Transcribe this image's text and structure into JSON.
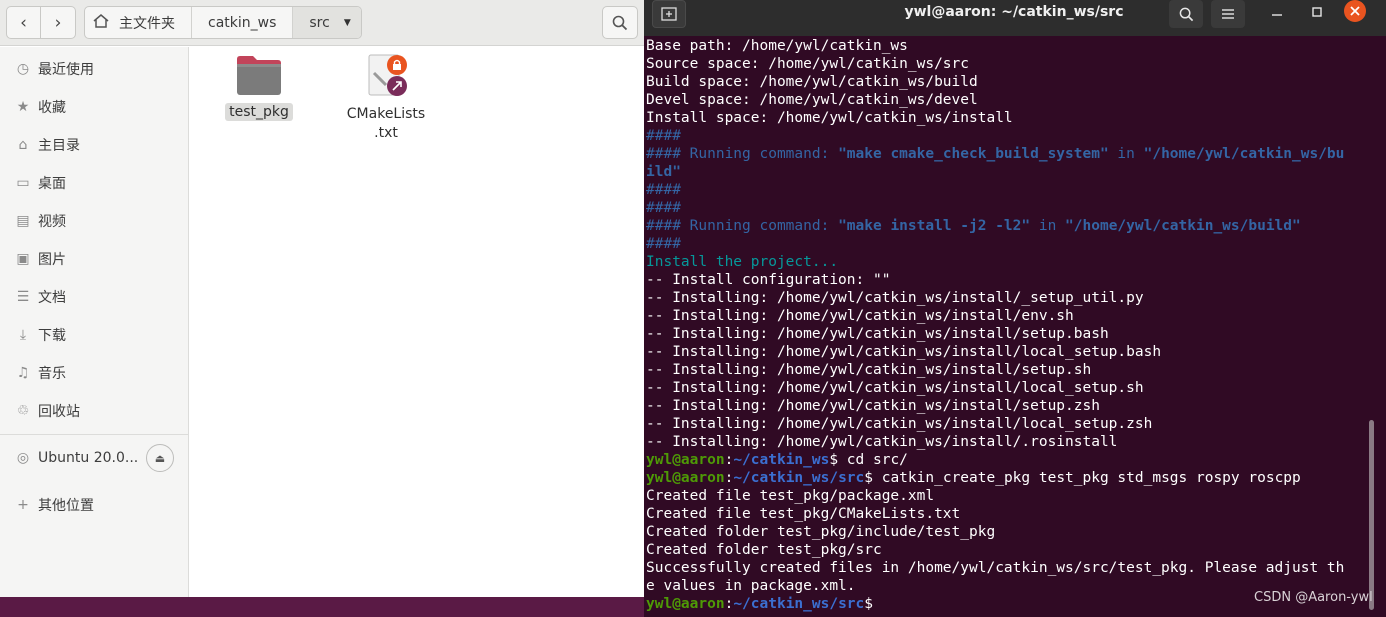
{
  "file_manager": {
    "breadcrumbs": [
      "主文件夹",
      "catkin_ws",
      "src"
    ],
    "sidebar": [
      {
        "label": "最近使用",
        "icon": "clock-icon"
      },
      {
        "label": "收藏",
        "icon": "star-icon"
      },
      {
        "label": "主目录",
        "icon": "home-icon"
      },
      {
        "label": "桌面",
        "icon": "desktop-icon"
      },
      {
        "label": "视频",
        "icon": "video-icon"
      },
      {
        "label": "图片",
        "icon": "image-icon"
      },
      {
        "label": "文档",
        "icon": "document-icon"
      },
      {
        "label": "下载",
        "icon": "download-icon"
      },
      {
        "label": "音乐",
        "icon": "music-icon"
      },
      {
        "label": "回收站",
        "icon": "trash-icon"
      },
      {
        "label": "Ubuntu 20.0...",
        "icon": "disc-icon"
      },
      {
        "label": "其他位置",
        "icon": "plus-icon"
      }
    ],
    "files": [
      {
        "name": "test_pkg",
        "type": "folder"
      },
      {
        "name": "CMakeLists\n.txt",
        "type": "text-file"
      }
    ]
  },
  "terminal": {
    "title": "ywl@aaron: ~/catkin_ws/src",
    "lines": [
      [
        [
          "",
          "Base path: /home/ywl/catkin_ws"
        ]
      ],
      [
        [
          "",
          "Source space: /home/ywl/catkin_ws/src"
        ]
      ],
      [
        [
          "",
          "Build space: /home/ywl/catkin_ws/build"
        ]
      ],
      [
        [
          "",
          "Devel space: /home/ywl/catkin_ws/devel"
        ]
      ],
      [
        [
          "",
          "Install space: /home/ywl/catkin_ws/install"
        ]
      ],
      [
        [
          "c-blue",
          "####"
        ]
      ],
      [
        [
          "c-blue",
          "#### Running command: "
        ],
        [
          "c-blueb",
          "\"make cmake_check_build_system\""
        ],
        [
          "c-blue",
          " in "
        ],
        [
          "c-blueb",
          "\"/home/ywl/catkin_ws/bu"
        ]
      ],
      [
        [
          "c-blueb",
          "ild\""
        ]
      ],
      [
        [
          "c-blue",
          "####"
        ]
      ],
      [
        [
          "c-blue",
          "####"
        ]
      ],
      [
        [
          "c-blue",
          "#### Running command: "
        ],
        [
          "c-blueb",
          "\"make install -j2 -l2\""
        ],
        [
          "c-blue",
          " in "
        ],
        [
          "c-blueb",
          "\"/home/ywl/catkin_ws/build\""
        ]
      ],
      [
        [
          "c-blue",
          "####"
        ]
      ],
      [
        [
          "c-cyan",
          "Install the project..."
        ]
      ],
      [
        [
          "",
          "-- Install configuration: \"\""
        ]
      ],
      [
        [
          "",
          "-- Installing: /home/ywl/catkin_ws/install/_setup_util.py"
        ]
      ],
      [
        [
          "",
          "-- Installing: /home/ywl/catkin_ws/install/env.sh"
        ]
      ],
      [
        [
          "",
          "-- Installing: /home/ywl/catkin_ws/install/setup.bash"
        ]
      ],
      [
        [
          "",
          "-- Installing: /home/ywl/catkin_ws/install/local_setup.bash"
        ]
      ],
      [
        [
          "",
          "-- Installing: /home/ywl/catkin_ws/install/setup.sh"
        ]
      ],
      [
        [
          "",
          "-- Installing: /home/ywl/catkin_ws/install/local_setup.sh"
        ]
      ],
      [
        [
          "",
          "-- Installing: /home/ywl/catkin_ws/install/setup.zsh"
        ]
      ],
      [
        [
          "",
          "-- Installing: /home/ywl/catkin_ws/install/local_setup.zsh"
        ]
      ],
      [
        [
          "",
          "-- Installing: /home/ywl/catkin_ws/install/.rosinstall"
        ]
      ],
      [
        [
          "c-green",
          "ywl@aaron"
        ],
        [
          "",
          ":"
        ],
        [
          "c-pblue",
          "~/catkin_ws"
        ],
        [
          "",
          "$ cd src/"
        ]
      ],
      [
        [
          "c-green",
          "ywl@aaron"
        ],
        [
          "",
          ":"
        ],
        [
          "c-pblue",
          "~/catkin_ws/src"
        ],
        [
          "",
          "$ catkin_create_pkg test_pkg std_msgs rospy roscpp"
        ]
      ],
      [
        [
          "",
          "Created file test_pkg/package.xml"
        ]
      ],
      [
        [
          "",
          "Created file test_pkg/CMakeLists.txt"
        ]
      ],
      [
        [
          "",
          "Created folder test_pkg/include/test_pkg"
        ]
      ],
      [
        [
          "",
          "Created folder test_pkg/src"
        ]
      ],
      [
        [
          "",
          "Successfully created files in /home/ywl/catkin_ws/src/test_pkg. Please adjust th"
        ]
      ],
      [
        [
          "",
          "e values in package.xml."
        ]
      ],
      [
        [
          "c-green",
          "ywl@aaron"
        ],
        [
          "",
          ":"
        ],
        [
          "c-pblue",
          "~/catkin_ws/src"
        ],
        [
          "",
          "$ "
        ]
      ]
    ]
  },
  "watermark": "CSDN @Aaron-ywl",
  "colors": {
    "terminal_bg": "#300a24",
    "ubuntu_orange": "#e95420",
    "prompt_green": "#4e9a06",
    "prompt_blue": "#3465a4"
  }
}
